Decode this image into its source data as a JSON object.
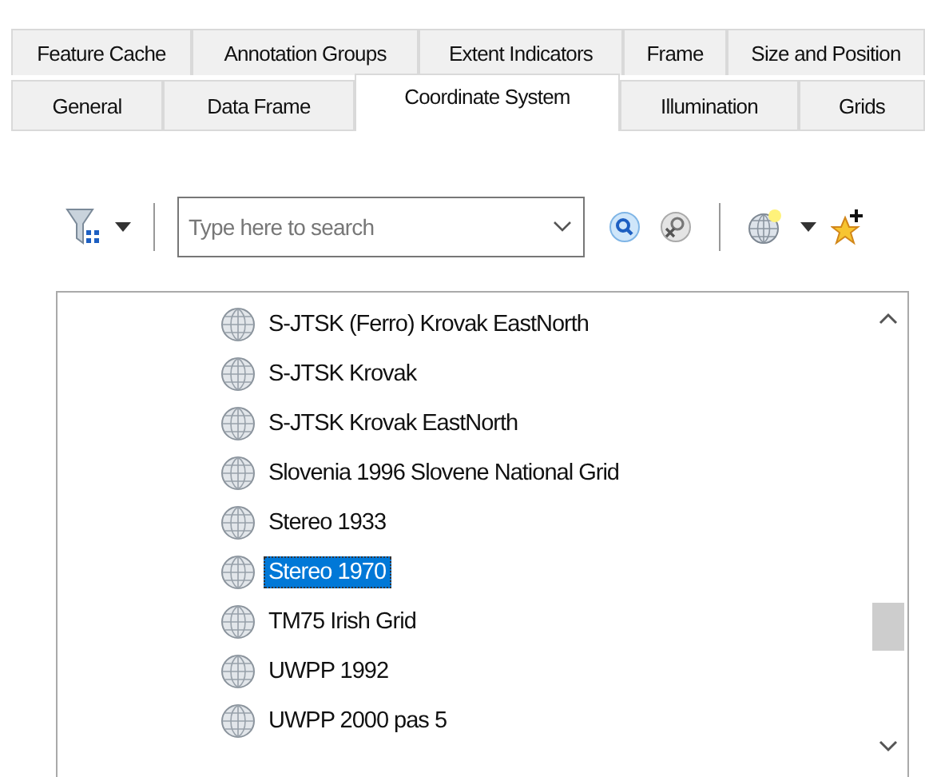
{
  "tabs_row_1": [
    {
      "label": "Feature Cache",
      "selected": false
    },
    {
      "label": "Annotation Groups",
      "selected": false
    },
    {
      "label": "Extent Indicators",
      "selected": false
    },
    {
      "label": "Frame",
      "selected": false
    },
    {
      "label": "Size and Position",
      "selected": false
    }
  ],
  "tabs_row_2": [
    {
      "label": "General",
      "selected": false
    },
    {
      "label": "Data Frame",
      "selected": false
    },
    {
      "label": "Coordinate System",
      "selected": true
    },
    {
      "label": "Illumination",
      "selected": false
    },
    {
      "label": "Grids",
      "selected": false
    }
  ],
  "search": {
    "placeholder": "Type here to search"
  },
  "list": {
    "items": [
      {
        "label": "S-JTSK (Ferro) Krovak EastNorth",
        "selected": false
      },
      {
        "label": "S-JTSK Krovak",
        "selected": false
      },
      {
        "label": "S-JTSK Krovak EastNorth",
        "selected": false
      },
      {
        "label": "Slovenia 1996 Slovene National Grid",
        "selected": false
      },
      {
        "label": "Stereo 1933",
        "selected": false
      },
      {
        "label": "Stereo 1970",
        "selected": true
      },
      {
        "label": "TM75 Irish Grid",
        "selected": false
      },
      {
        "label": "UWPP 1992",
        "selected": false
      },
      {
        "label": "UWPP 2000 pas 5",
        "selected": false
      }
    ]
  }
}
